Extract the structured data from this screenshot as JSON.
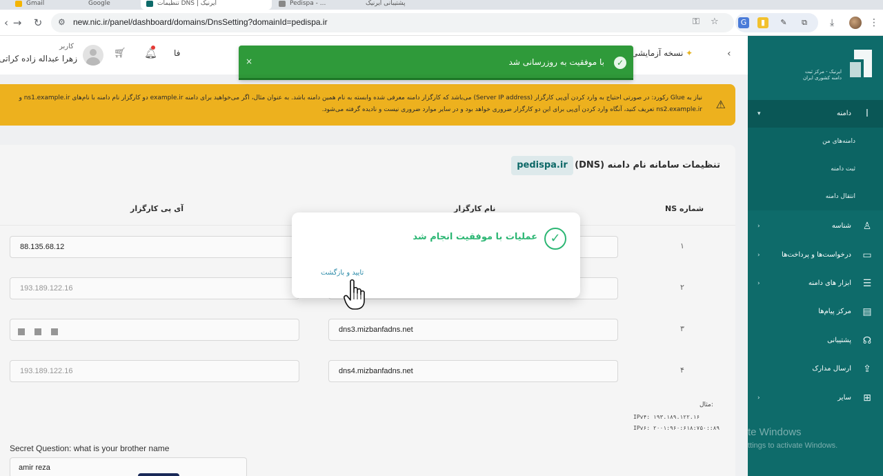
{
  "browser": {
    "tabs": [
      {
        "label": "Gmail"
      },
      {
        "label": "Google"
      },
      {
        "label": "تنظیمات DNS | ایرنیک"
      },
      {
        "label": "Pedispa - ..."
      },
      {
        "label": "پشتیبانی ایرنیک"
      }
    ],
    "url": "new.nic.ir/panel/dashboard/domains/DnsSetting?domainId=pedispa.ir",
    "icons": [
      "back-icon",
      "forward-icon",
      "reload-icon",
      "key-icon",
      "star-icon",
      "translate-icon",
      "extension-icon",
      "download-icon",
      "menu-icon"
    ]
  },
  "sidebar": {
    "logo_text_line1": "ایرنیک - مرکز ثبت",
    "logo_text_line2": "دامنه کشوری ایران",
    "items": [
      {
        "label": "دامنه",
        "icon": "chart-icon",
        "expanded": true
      },
      {
        "label": "شناسه",
        "icon": "user-icon"
      },
      {
        "label": "درخواست‌ها و پرداخت‌ها",
        "icon": "card-icon"
      },
      {
        "label": "ابزار های دامنه",
        "icon": "sliders-icon"
      },
      {
        "label": "مرکز پیام‌ها",
        "icon": "message-icon"
      },
      {
        "label": "پشتیبانی",
        "icon": "headset-icon"
      },
      {
        "label": "ارسال مدارک",
        "icon": "upload-icon"
      },
      {
        "label": "سایر",
        "icon": "grid-icon"
      }
    ],
    "subitems": [
      "دامنه‌های من",
      "ثبت دامنه",
      "انتقال دامنه"
    ],
    "activate_line1": "te Windows",
    "activate_line2": "ttings to activate Windows."
  },
  "header": {
    "trial": "نسخه آزمایشی",
    "lang": "فا",
    "user_role": "کاربر",
    "user_name": "زهرا عبداله زاده کراتی"
  },
  "toast": {
    "text": "با موفقیت به روزرسانی شد",
    "close": "×"
  },
  "warning": {
    "text": "نیاز به Glue رکورد: در صورتی احتیاج به وارد کردن آی‌پی کارگزار (Server IP address) می‌باشد که کارگزار دامنه معرفی شده وابسته به نام همین دامنه باشد. به عنوان مثال، اگر می‌خواهید برای دامنه example.ir دو کارگزار نام دامنه با نام‌های ns1.example.ir و ns2.example.ir تعریف کنید، آنگاه وارد کردن آی‌پی برای این دو کارگزار ضروری خواهد بود و در سایر موارد ضروری نیست و نادیده گرفته می‌شود."
  },
  "dns": {
    "title": "تنظیمات سامانه نام دامنه (DNS)",
    "domain": "pedispa.ir",
    "col_ns": "شماره NS",
    "col_name": "نام کارگزار",
    "col_ip": "آی پی کارگزار",
    "rows": [
      {
        "num": "۱",
        "name": "",
        "ip": "88.135.68.12"
      },
      {
        "num": "۲",
        "name": "",
        "ip": "193.189.122.16"
      },
      {
        "num": "۳",
        "name": "dns3.mizbanfadns.net",
        "ip": ""
      },
      {
        "num": "۴",
        "name": "dns4.mizbanfadns.net",
        "ip": "193.189.122.16"
      }
    ],
    "example_label": "مثال:",
    "example_ipv4": "IPv۴: ۱۹۳.۱۸۹.۱۲۲.۱۶",
    "example_ipv6": "IPv۶: ۲۰۰۱:۹۶۰:۶۱۸:۷۵۰::۸۹"
  },
  "secret": {
    "question": "Secret Question: what is your brother name",
    "answer": "amir reza"
  },
  "modal": {
    "title": "عملیات با موفقیت انجام شد",
    "confirm": "تایید و بازگشت"
  },
  "colors": {
    "sidebar": "#0e6b6a",
    "toast": "#2f9a3a",
    "warning": "#f2b51f",
    "success": "#2bb673"
  }
}
